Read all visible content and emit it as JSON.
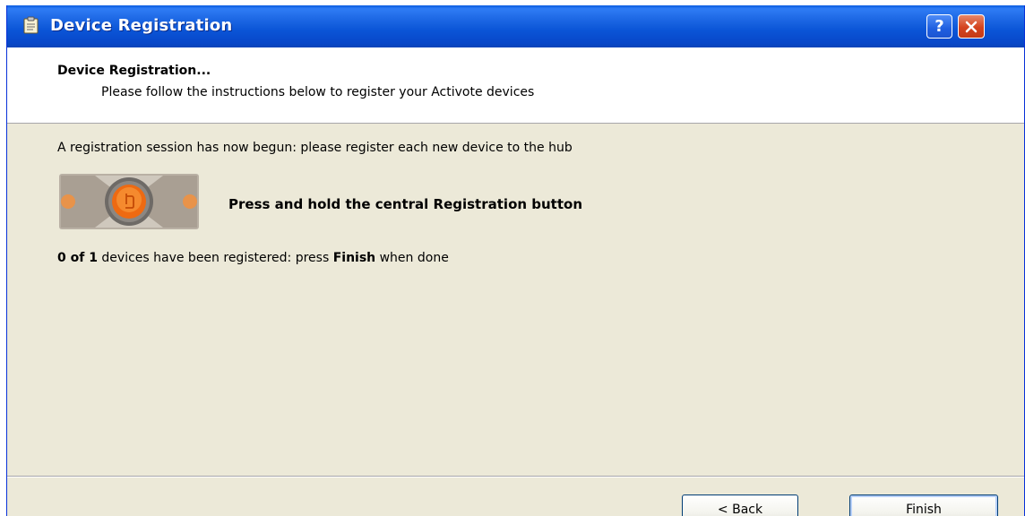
{
  "window": {
    "title": "Device Registration",
    "help_label": "?"
  },
  "header": {
    "title": "Device Registration...",
    "subtitle": "Please follow the instructions below to register your Activote devices"
  },
  "content": {
    "session_text": "A registration session has now begun: please register each new device to the hub",
    "instruction": "Press and hold the central Registration button",
    "status": {
      "count_bold": "0 of 1",
      "mid_text": " devices have been registered: press ",
      "finish_bold": "Finish",
      "end_text": " when done"
    }
  },
  "buttons": {
    "back_label": "< Back",
    "finish_label": "Finish"
  }
}
